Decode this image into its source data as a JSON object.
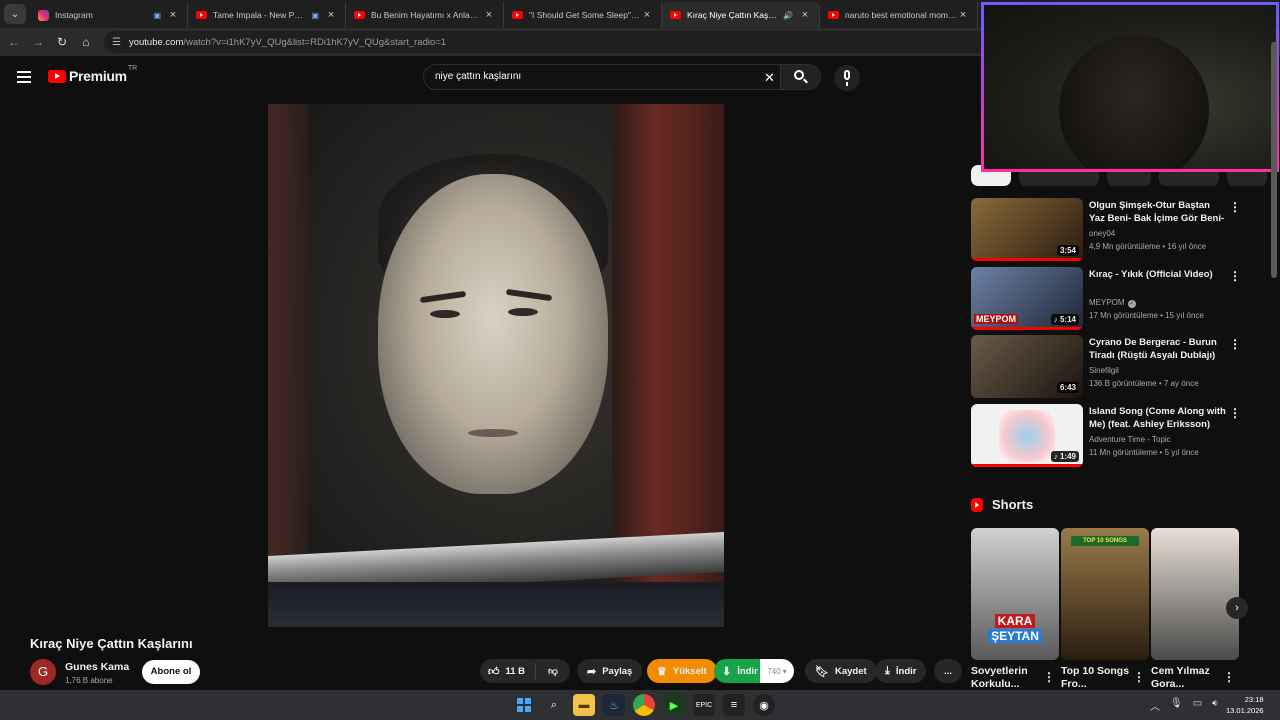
{
  "browser": {
    "tabs": [
      {
        "title": "Instagram",
        "favicon": "instagram-icon",
        "active": false
      },
      {
        "title": "Tame Impala - New Person, Same Old Mistakes",
        "favicon": "youtube-icon",
        "active": false
      },
      {
        "title": "Bu Benim Hayatımı x Anlamazdın",
        "favicon": "youtube-icon",
        "active": false
      },
      {
        "title": "\"I Should Get Some Sleep\" Meme",
        "favicon": "youtube-icon",
        "active": false
      },
      {
        "title": "Kıraç Niye Çattın Kaşlarını - YouTube",
        "favicon": "youtube-icon",
        "active": true
      },
      {
        "title": "naruto best emotional moments",
        "favicon": "youtube-icon",
        "active": false
      }
    ],
    "url_host": "youtube.com",
    "url_path": "/watch?v=i1hK7yV_QUg&list=RDi1hK7yV_QUg&start_radio=1"
  },
  "header": {
    "logo_text": "Premium",
    "country_code": "TR",
    "search_query": "niye çattın kaşlarını"
  },
  "video": {
    "title": "Kıraç Niye Çattın Kaşlarını",
    "channel": "Gunes Kama",
    "channel_initial": "G",
    "subscribers": "1,76 B abone",
    "subscribe_label": "Abone ol",
    "likes": "11 B",
    "share_label": "Paylaş",
    "upgrade_label": "Yükselt",
    "ext_download_label": "İndir",
    "ext_download_count": "740",
    "save_label": "Kaydet",
    "download_label": "İndir",
    "more_label": "..."
  },
  "sidebar": {
    "recommendations": [
      {
        "title": "Olgun Şimşek-Otur Baştan Yaz Beni- Bak İçime Gör Beni- Kap...",
        "channel": "oney04",
        "meta": "4,9 Mn görüntüleme • 16 yıl önce",
        "duration": "3:54",
        "verified": false,
        "thumb_colors": [
          "#6b4b2a",
          "#2a1c10"
        ]
      },
      {
        "title": "Kıraç - Yıkık (Official Video)",
        "channel": "MEYPOM",
        "meta": "17 Mn görüntüleme • 15 yıl önce",
        "duration": "5:14",
        "verified": true,
        "overlay": "MEYPOM",
        "thumb_colors": [
          "#5a6b8a",
          "#1e2636"
        ]
      },
      {
        "title": "Cyrano De Bergerac - Burun Tiradı (Rüştü Asyalı Dublajı)",
        "channel": "Sinefilgil",
        "meta": "136 B görüntüleme • 7 ay önce",
        "duration": "6:43",
        "verified": false,
        "thumb_colors": [
          "#5a4a3a",
          "#1a1410"
        ]
      },
      {
        "title": "Island Song (Come Along with Me) (feat. Ashley Eriksson)",
        "channel": "Adventure Time - Topic",
        "meta": "11 Mn görüntüleme • 5 yıl önce",
        "duration": "1:49",
        "verified": false,
        "thumb_colors": [
          "#e8e8e8",
          "#f6d3d3"
        ]
      }
    ],
    "shorts_heading": "Shorts",
    "shorts": [
      {
        "title": "Sovyetlerin Korkulu...",
        "overlay": "KARA ŞEYTAN",
        "thumb_colors": [
          "#c8c8c8",
          "#3a3a3a"
        ]
      },
      {
        "title": "Top 10 Songs Fro...",
        "overlay": "TOP 10 SONGS",
        "thumb_colors": [
          "#8a6a3a",
          "#2a1e10"
        ]
      },
      {
        "title": "Cem Yılmaz Gora...",
        "overlay": "",
        "thumb_colors": [
          "#bbbbbb",
          "#444444"
        ]
      }
    ]
  },
  "taskbar": {
    "time": "23:18",
    "date": "13.01.2026"
  }
}
